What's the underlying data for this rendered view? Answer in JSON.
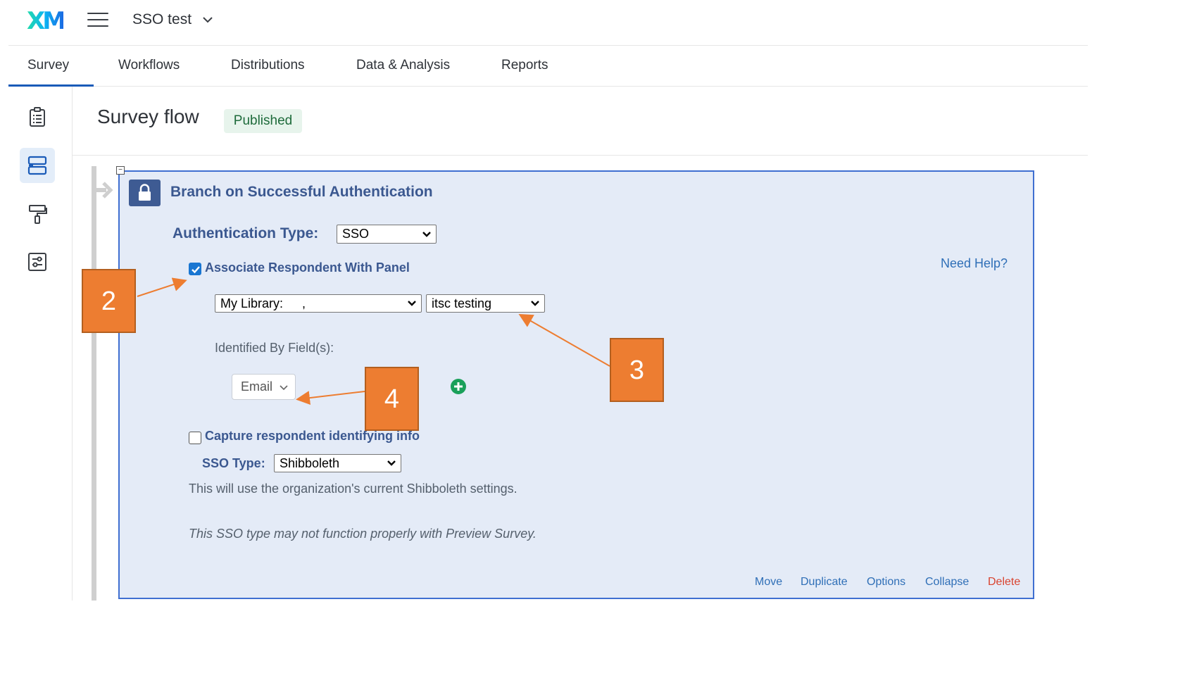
{
  "app": {
    "logo": "XM",
    "project_name": "SSO test"
  },
  "nav": {
    "tabs": [
      "Survey",
      "Workflows",
      "Distributions",
      "Data & Analysis",
      "Reports"
    ],
    "active_tab": "Survey"
  },
  "sidebar": {
    "icons": [
      "survey-clipboard-icon",
      "survey-flow-icon",
      "look-and-feel-icon",
      "survey-options-icon"
    ],
    "active": "survey-flow-icon"
  },
  "header": {
    "title": "Survey flow",
    "status_badge": "Published"
  },
  "flow_element": {
    "title": "Branch on Successful Authentication",
    "auth_type_label": "Authentication Type:",
    "auth_type_value": "SSO",
    "associate_panel": {
      "label": "Associate Respondent With Panel",
      "checked": true
    },
    "need_help": "Need Help?",
    "library_select": "My Library:",
    "library_suffix": ",",
    "panel_select": "itsc testing",
    "identified_by_label": "Identified By Field(s):",
    "identified_field": "Email",
    "capture_info": {
      "label": "Capture respondent identifying info",
      "checked": false
    },
    "sso_type_label": "SSO Type:",
    "sso_type_value": "Shibboleth",
    "info_text": "This will use the organization's current Shibboleth settings.",
    "warning_text": "This SSO type may not function properly with Preview Survey.",
    "actions": [
      "Move",
      "Duplicate",
      "Options",
      "Collapse",
      "Delete"
    ]
  },
  "callouts": [
    "2",
    "3",
    "4"
  ],
  "colors": {
    "accent": "#1a5bb8",
    "panel_bg": "#e4ebf7",
    "panel_border": "#3f6fd1",
    "callout": "#ed7d31",
    "delete": "#d9432f",
    "badge_bg": "#e7f4ec"
  }
}
